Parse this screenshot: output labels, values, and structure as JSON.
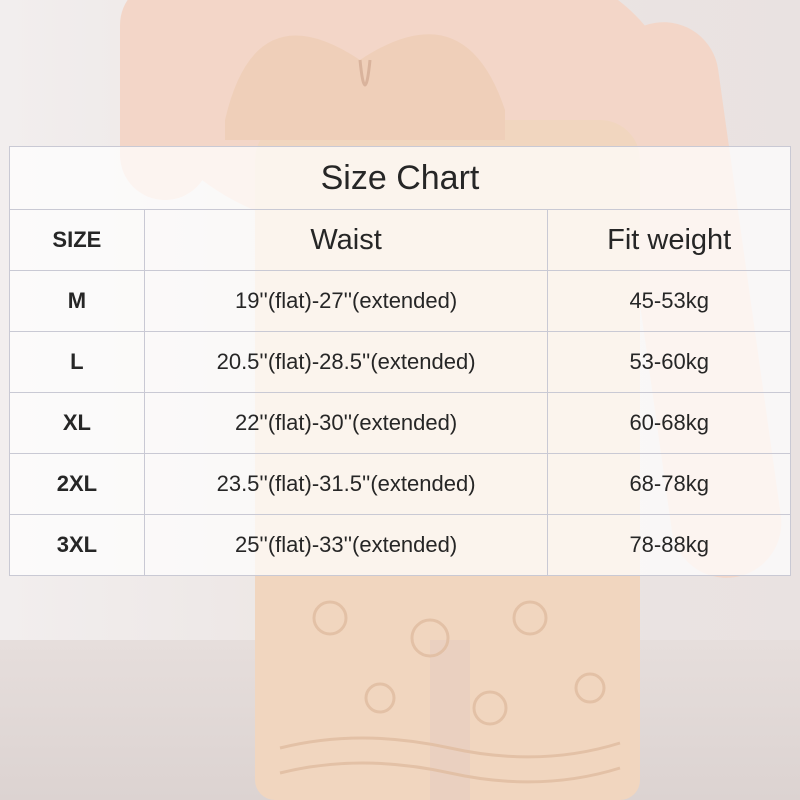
{
  "chart_title": "Size Chart",
  "columns": [
    "SIZE",
    "Waist",
    "Fit weight"
  ],
  "rows": [
    {
      "size": "M",
      "waist": "19''(flat)-27''(extended)",
      "weight": "45-53kg"
    },
    {
      "size": "L",
      "waist": "20.5''(flat)-28.5''(extended)",
      "weight": "53-60kg"
    },
    {
      "size": "XL",
      "waist": "22''(flat)-30''(extended)",
      "weight": "60-68kg"
    },
    {
      "size": "2XL",
      "waist": "23.5''(flat)-31.5''(extended)",
      "weight": "68-78kg"
    },
    {
      "size": "3XL",
      "waist": "25''(flat)-33''(extended)",
      "weight": "78-88kg"
    }
  ],
  "colors": {
    "garment": "#f1d6bf",
    "skin": "#f3d6c8",
    "text": "#262626",
    "grid": "#c9c9d4"
  }
}
